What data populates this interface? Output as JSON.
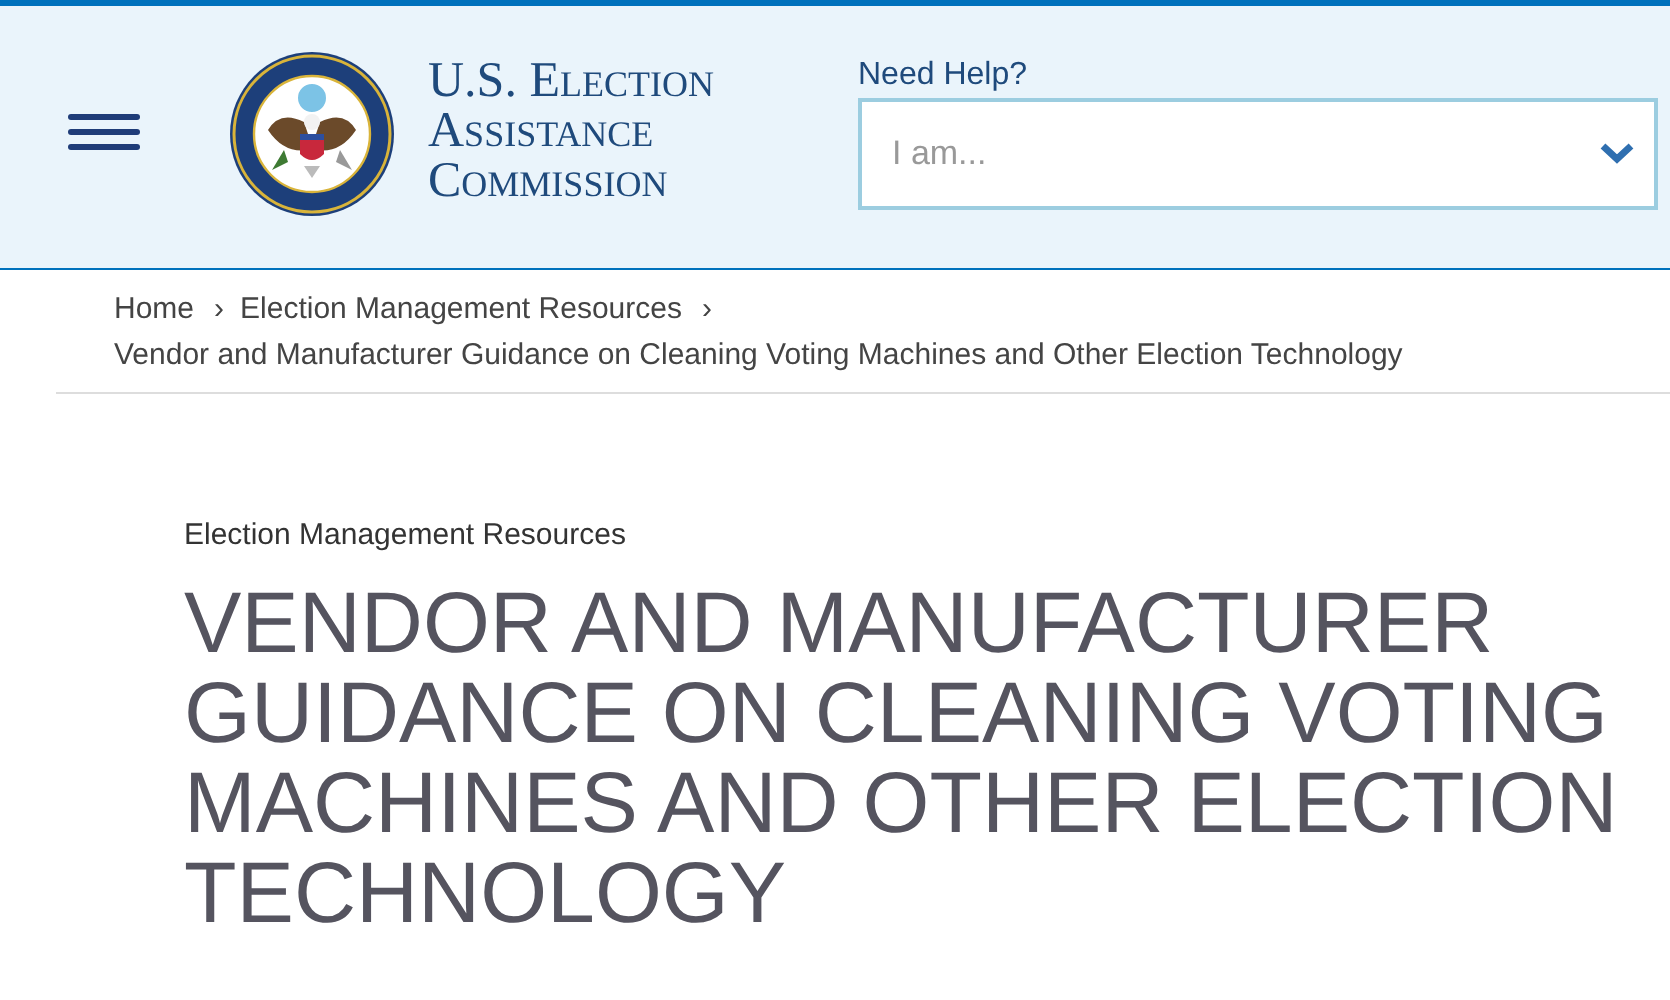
{
  "header": {
    "logo_lines": [
      "U.S. Election",
      "Assistance",
      "Commission"
    ],
    "help_label": "Need Help?",
    "help_select": {
      "placeholder": "I am..."
    }
  },
  "breadcrumb": [
    {
      "label": "Home",
      "separator": "›"
    },
    {
      "label": "Election Management Resources",
      "separator": "›"
    },
    {
      "label": "Vendor and Manufacturer Guidance on Cleaning Voting Machines and Other Election Technology"
    }
  ],
  "category": "Election Management Resources",
  "title": "VENDOR AND MANUFACTURER GUIDANCE ON CLEANING VOTING MACHINES AND OTHER ELECTION TECHNOLOGY"
}
